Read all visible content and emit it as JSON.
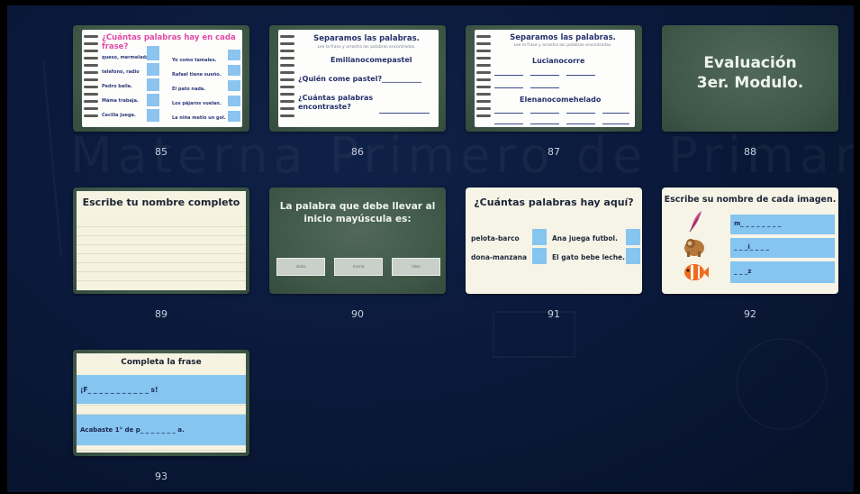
{
  "background": {
    "watermark": "Materna Primero de Primaria"
  },
  "slides": [
    {
      "number": "85",
      "title": "¿Cuántas palabras hay en cada frase?",
      "left_items": [
        "queso, mermelada",
        "teléfono, radio",
        "Pedro baila.",
        "Máma trabaja.",
        "Cecilia juega."
      ],
      "right_items": [
        "Yo como tamales.",
        "Rafael tiene sueño.",
        "El pato nada.",
        "Los pájaros vuelan.",
        "La niña metio un gol."
      ]
    },
    {
      "number": "86",
      "title": "Separamos las palabras.",
      "subtitle": "Lee la frase y arrastra las palabras encontradas.",
      "phrase": "Emilianocomepastel",
      "question1": "¿Quién come pastel?___________",
      "question2": "¿Cuántas palabras encontraste?"
    },
    {
      "number": "87",
      "title": "Separamos las palabras.",
      "subtitle": "Lee la frase y arrastra las palabras encontradas.",
      "phrase1": "Lucianocorre",
      "phrase2": "Elenanocomehelado"
    },
    {
      "number": "88",
      "line1": "Evaluación",
      "line2": "3er. Modulo."
    },
    {
      "number": "89",
      "title": "Escribe tu nombre completo"
    },
    {
      "number": "90",
      "title": "La palabra que debe llevar al inicio mayúscula es:",
      "options": [
        "aloto",
        "maria",
        "lobo"
      ]
    },
    {
      "number": "91",
      "title": "¿Cuántas palabras hay aquí?",
      "items": [
        "pelota-barco",
        "Ana juega futbol.",
        "dona-manzana",
        "El gato bebe leche."
      ]
    },
    {
      "number": "92",
      "title": "Escribe su nombre de cada imagen.",
      "blanks": [
        "m_ _ _ _ _ _ _ _",
        "_ _ _i_ _ _ _",
        "_ _ _z"
      ]
    },
    {
      "number": "93",
      "title": "Completa la frase",
      "line1": "¡F_ _ _ _ _ _ _ _ _ _ _ s!",
      "line2": "Acabaste 1° de  p_ _ _ _ _ _ _ a."
    }
  ]
}
